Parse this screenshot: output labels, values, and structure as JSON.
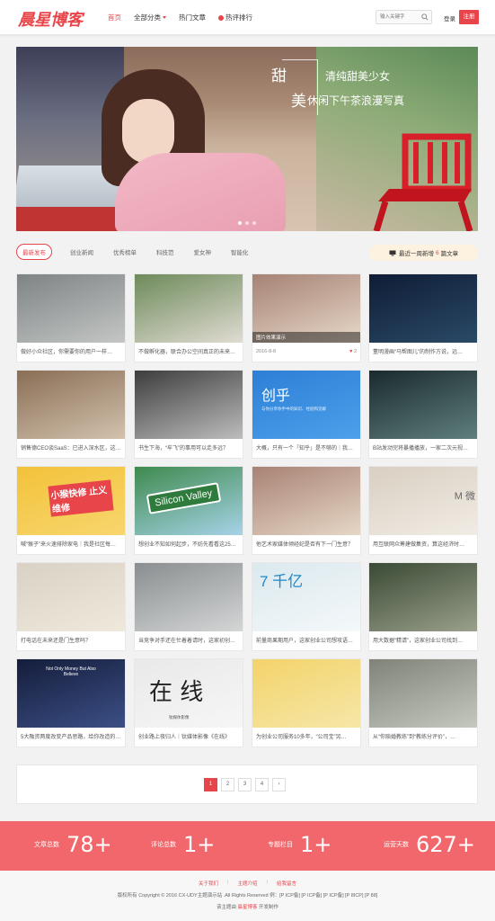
{
  "header": {
    "logo": "晨星博客",
    "nav": [
      {
        "label": "首页",
        "active": true
      },
      {
        "label": "全部分类",
        "dropdown": true
      },
      {
        "label": "热门文章"
      },
      {
        "label": "热评排行",
        "hot": true
      }
    ],
    "search_placeholder": "输入关键字",
    "login": "登录",
    "register": "注册"
  },
  "banner": {
    "big1": "甜",
    "big2": "美",
    "line1": "清纯甜美少女",
    "line2": "休闲下午茶浪漫写真"
  },
  "tabs": [
    "最新发布",
    "创业新闻",
    "优秀榜单",
    "科技范",
    "爱女神",
    "智能化"
  ],
  "recent": {
    "prefix": "最近一周新增",
    "count": "6",
    "suffix": "篇文章"
  },
  "cards": [
    {
      "title": "做好小众社区，你需要你的用户一样…",
      "colors": [
        "#7e8385",
        "#c3c6c4"
      ]
    },
    {
      "title": "不做孵化器，联合办公空间真正的未来…",
      "colors": [
        "#6d8a5a",
        "#e0dcd2"
      ]
    },
    {
      "title": "图片效果演示",
      "colors": [
        "#a58274",
        "#e7d8c8"
      ],
      "date": "2016-8-8",
      "likes": "2"
    },
    {
      "title": "董明漫画“马帮图儿”的制作方说，远…",
      "colors": [
        "#0f1c36",
        "#2a4a66"
      ]
    },
    {
      "title": "销售德CEO谈SaaS：已进入深水区，这…",
      "colors": [
        "#8a6e55",
        "#d2c2ad"
      ]
    },
    {
      "title": "书生下海，“牟飞”的事用可以走多远？",
      "colors": [
        "#3d3d3d",
        "#bdbdbd"
      ]
    },
    {
      "title": "大概，只有一个「知乎」是不够的｜我…",
      "colors": [
        "#2c7fd6",
        "#4da0ea"
      ],
      "logo_text": "创乎",
      "logo_sub": "与你分享你手中的知识、经验和见解"
    },
    {
      "title": "B站发动完将暴播播放，一家二次元视…",
      "colors": [
        "#1a2a2e",
        "#5f7f7c"
      ]
    },
    {
      "title": "喊“猴子”来火速排除家电｜我是社区每…",
      "colors": [
        "#f2c23a",
        "#f8d66e"
      ],
      "banner_text": "小猴快修 止义维修"
    },
    {
      "title": "想创业不知如何起步，不妨先看看这25…",
      "colors": [
        "#3e8a4e",
        "#a6d3e8"
      ],
      "sign_text": "Silicon Valley"
    },
    {
      "title": "他艺术家媒体倾经纪是否有下一门生意？",
      "colors": [
        "#a88274",
        "#e6d7c6"
      ]
    },
    {
      "title": "用互联网众筹建做集资，算这经济时…",
      "colors": [
        "#d9cfc2",
        "#f1ece4"
      ],
      "side_text": "M 微"
    },
    {
      "title": "打电话在未来还是门生意吗？",
      "colors": [
        "#d9d1c3",
        "#efe9dd"
      ]
    },
    {
      "title": "当竞争对手还在忙着着请时，这家初创…",
      "colors": [
        "#8a8e90",
        "#d4d6d6"
      ]
    },
    {
      "title": "前量商果期用户，这家创业公司想攻语…",
      "colors": [
        "#dbe9ee",
        "#f4f8fa"
      ],
      "big_text": "7 千亿"
    },
    {
      "title": "用大数据“精请”，这家创业公司找到…",
      "colors": [
        "#3a4a34",
        "#9aa08c"
      ]
    },
    {
      "title": "5大融资两度改变产品思路，给你改造的…",
      "colors": [
        "#141d3a",
        "#3c4f86"
      ],
      "stage_text": "Not Only Money But Also Believe"
    },
    {
      "title": "创业路上夜归人｜钛媒体影像《在线》",
      "colors": [
        "#e9e9e9",
        "#f6f6f6"
      ],
      "calligraphy": "在 线",
      "stamp": "钛媒体影像"
    },
    {
      "title": "为创业公司服务10多年，“公司宝”另…",
      "colors": [
        "#f3d36a",
        "#f6e7a8"
      ]
    },
    {
      "title": "从“你赔婚教练”到“教练分评价”，…",
      "colors": [
        "#7f8378",
        "#c5c8bf"
      ]
    }
  ],
  "pager": [
    "1",
    "2",
    "3",
    "4",
    "›"
  ],
  "stats": [
    {
      "label": "文章总数",
      "value": "78+"
    },
    {
      "label": "评论总数",
      "value": "1+"
    },
    {
      "label": "专题栏目",
      "value": "1+"
    },
    {
      "label": "运营天数",
      "value": "627+"
    }
  ],
  "footer": {
    "links": [
      "关于我们",
      "主题介绍",
      "给我留言"
    ],
    "copyright": "版权所有 Copyright © 2016 CX-UDY主题演示站 .All Rights Reserved 例：[P ICP备]  [P ICP备]  [P ICP备]  [P 8ICP]  [P 88]",
    "theme_prefix": "该主题由",
    "theme_name": "晨星博客",
    "theme_suffix": "开发制作"
  }
}
